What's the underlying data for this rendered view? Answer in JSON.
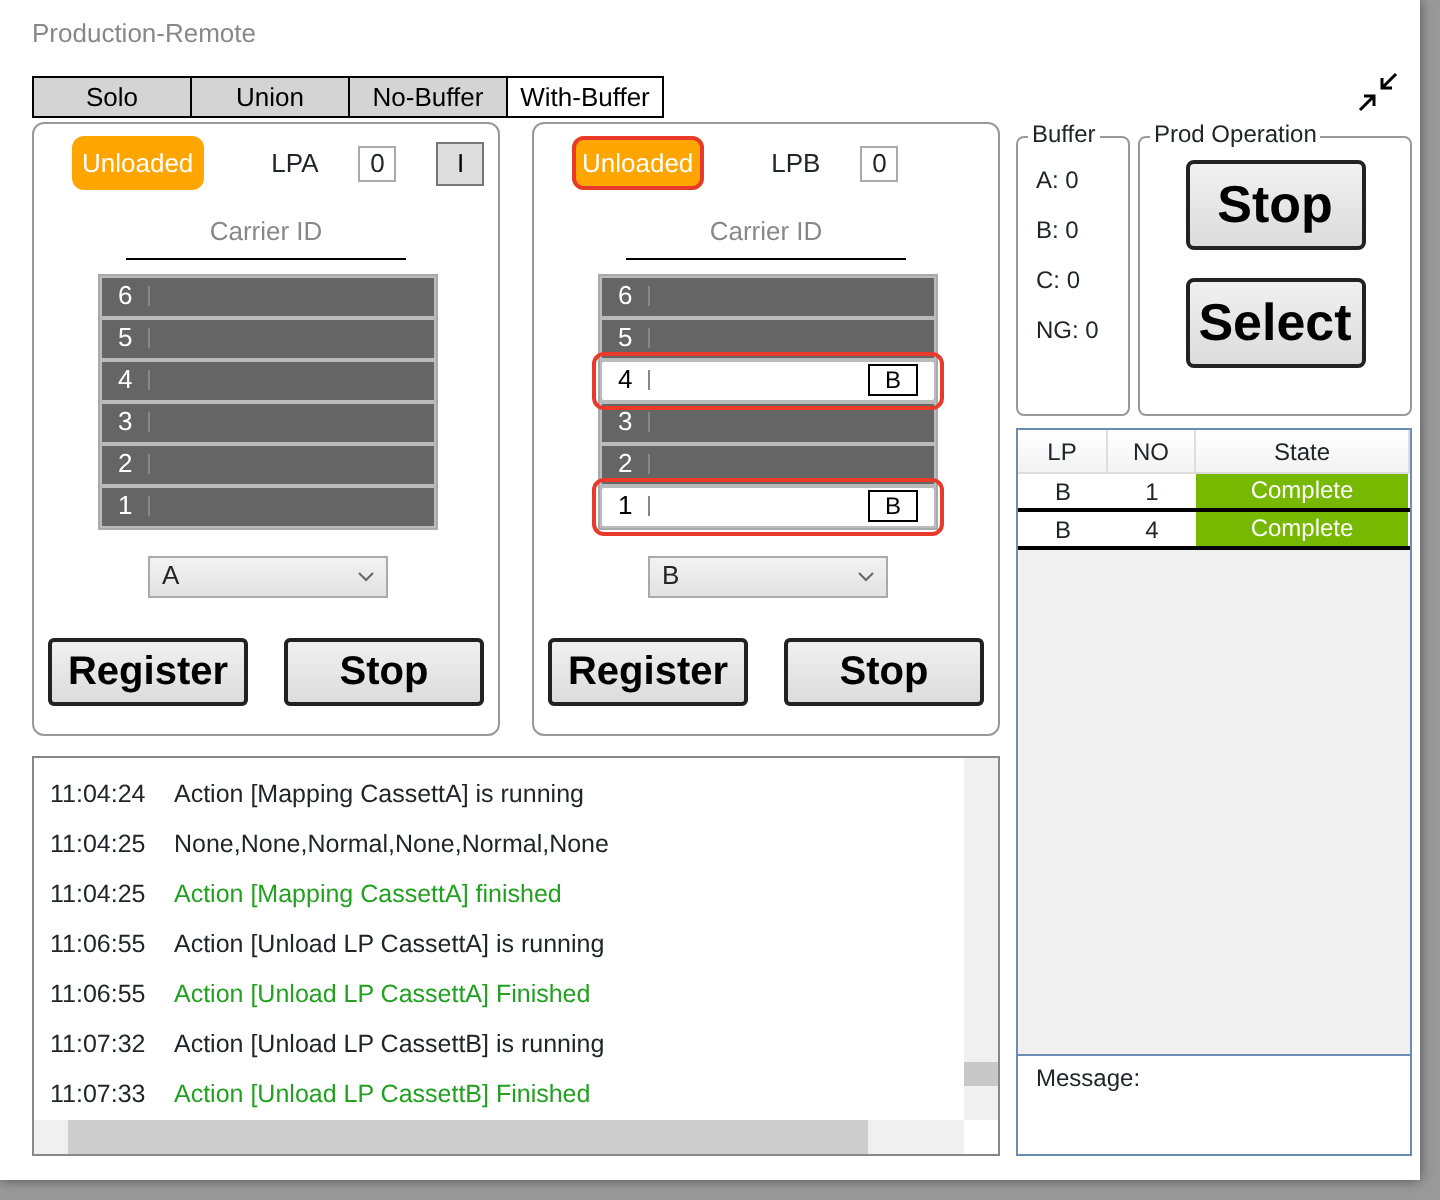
{
  "window": {
    "title": "Production-Remote"
  },
  "tabs": [
    {
      "label": "Solo",
      "selected": false
    },
    {
      "label": "Union",
      "selected": false
    },
    {
      "label": "No-Buffer",
      "selected": false
    },
    {
      "label": "With-Buffer",
      "selected": true
    }
  ],
  "load_ports": [
    {
      "status": "Unloaded",
      "status_highlighted": false,
      "name": "LPA",
      "count": "0",
      "extra_button": "I",
      "carrier_id_label": "Carrier ID",
      "slots": [
        {
          "number": "6",
          "loaded": false,
          "highlighted": false
        },
        {
          "number": "5",
          "loaded": false,
          "highlighted": false
        },
        {
          "number": "4",
          "loaded": false,
          "highlighted": false
        },
        {
          "number": "3",
          "loaded": false,
          "highlighted": false
        },
        {
          "number": "2",
          "loaded": false,
          "highlighted": false
        },
        {
          "number": "1",
          "loaded": false,
          "highlighted": false
        }
      ],
      "dropdown": "A",
      "buttons": [
        "Register",
        "Stop"
      ]
    },
    {
      "status": "Unloaded",
      "status_highlighted": true,
      "name": "LPB",
      "count": "0",
      "carrier_id_label": "Carrier ID",
      "slots": [
        {
          "number": "6",
          "loaded": false,
          "highlighted": false
        },
        {
          "number": "5",
          "loaded": false,
          "highlighted": false
        },
        {
          "number": "4",
          "loaded": true,
          "highlighted": true,
          "tag": "B"
        },
        {
          "number": "3",
          "loaded": false,
          "highlighted": false
        },
        {
          "number": "2",
          "loaded": false,
          "highlighted": false
        },
        {
          "number": "1",
          "loaded": true,
          "highlighted": true,
          "tag": "B"
        }
      ],
      "dropdown": "B",
      "buttons": [
        "Register",
        "Stop"
      ]
    }
  ],
  "buffer": {
    "title": "Buffer",
    "items": [
      "A: 0",
      "B: 0",
      "C: 0",
      "NG: 0"
    ]
  },
  "prod_operation": {
    "title": "Prod Operation",
    "buttons": [
      "Stop",
      "Select"
    ]
  },
  "table": {
    "columns": [
      "LP",
      "NO",
      "State"
    ],
    "rows": [
      {
        "lp": "B",
        "no": "1",
        "state": "Complete"
      },
      {
        "lp": "B",
        "no": "4",
        "state": "Complete"
      }
    ]
  },
  "message": {
    "label": "Message:"
  },
  "log": [
    {
      "time": "11:04:24",
      "text": "Action [Mapping CassettA] is running",
      "kind": "info"
    },
    {
      "time": "11:04:25",
      "text": "None,None,Normal,None,Normal,None",
      "kind": "info"
    },
    {
      "time": "11:04:25",
      "text": "Action [Mapping CassettA] finished",
      "kind": "success"
    },
    {
      "time": "11:06:55",
      "text": "Action [Unload LP CassettA] is running",
      "kind": "info"
    },
    {
      "time": "11:06:55",
      "text": "Action [Unload LP CassettA] Finished",
      "kind": "success"
    },
    {
      "time": "11:07:32",
      "text": "Action [Unload LP CassettB] is running",
      "kind": "info"
    },
    {
      "time": "11:07:33",
      "text": "Action [Unload LP CassettB] Finished",
      "kind": "success"
    }
  ]
}
